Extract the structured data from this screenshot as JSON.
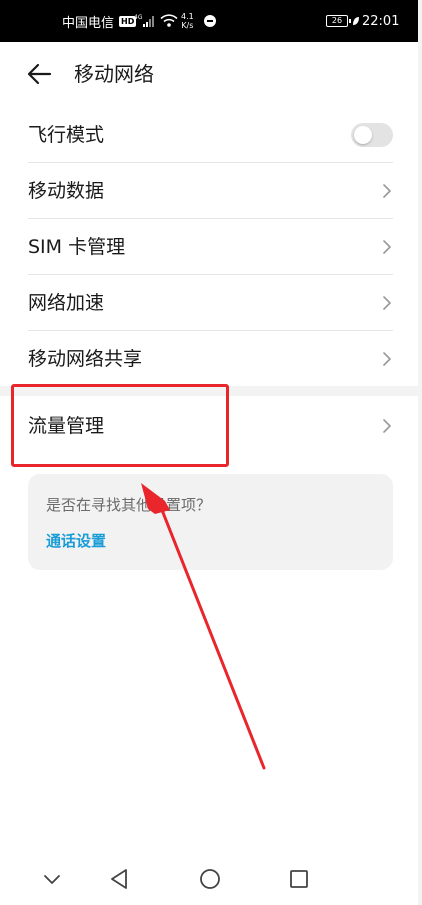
{
  "status_bar": {
    "carrier": "中国电信",
    "hd_badge": "HD",
    "network_type": "4G",
    "speed_value": "4.1",
    "speed_unit": "K/s",
    "battery": "26",
    "time": "22:01"
  },
  "header": {
    "title": "移动网络"
  },
  "settings": {
    "items": [
      {
        "label": "飞行模式",
        "control": "toggle",
        "enabled": false
      },
      {
        "label": "移动数据",
        "control": "chevron"
      },
      {
        "label": "SIM 卡管理",
        "control": "chevron"
      },
      {
        "label": "网络加速",
        "control": "chevron"
      },
      {
        "label": "移动网络共享",
        "control": "chevron"
      },
      {
        "label": "流量管理",
        "control": "chevron"
      }
    ]
  },
  "suggestion": {
    "question": "是否在寻找其他设置项？",
    "link": "通话设置"
  },
  "colors": {
    "status_bar_bg": "#000000",
    "accent": "#1a9cd6",
    "annotation_red": "#e8262b",
    "divider": "#e6e6e6"
  },
  "icons": {
    "back": "back-arrow-icon",
    "chevron": "chevron-right-icon",
    "nav_down": "chevron-down-icon",
    "nav_back": "triangle-back-icon",
    "nav_home": "circle-home-icon",
    "nav_recent": "square-recent-icon"
  }
}
